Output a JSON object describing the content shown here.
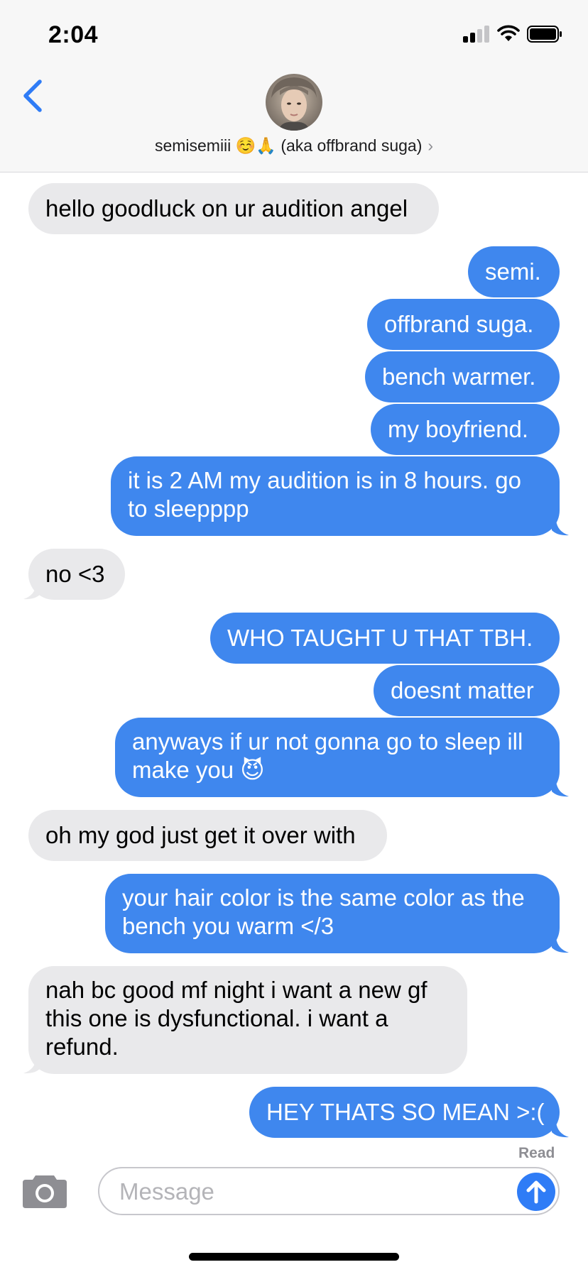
{
  "status_bar": {
    "time": "2:04"
  },
  "header": {
    "contact_name": "semisemiii ☺️🙏 (aka offbrand suga)",
    "chevron": "›"
  },
  "messages": [
    {
      "from": "them",
      "text": "hello goodluck on ur audition angel"
    },
    {
      "from": "me",
      "text": "semi."
    },
    {
      "from": "me",
      "text": "offbrand suga."
    },
    {
      "from": "me",
      "text": "bench warmer."
    },
    {
      "from": "me",
      "text": "my boyfriend."
    },
    {
      "from": "me",
      "text": "it is 2 AM my audition is in 8 hours. go to sleepppp"
    },
    {
      "from": "them",
      "text": "no <3"
    },
    {
      "from": "me",
      "text": "WHO TAUGHT U THAT TBH."
    },
    {
      "from": "me",
      "text": "doesnt matter"
    },
    {
      "from": "me",
      "text": "anyways if ur not gonna go to sleep ill make you 😈"
    },
    {
      "from": "them",
      "text": "oh my god just get it over with"
    },
    {
      "from": "me",
      "text": "your hair color is the same color as the bench you warm </3"
    },
    {
      "from": "them",
      "text": "nah bc good mf night i want a new gf this one is dysfunctional. i want a refund."
    },
    {
      "from": "me",
      "text": "HEY THATS SO MEAN >:("
    }
  ],
  "read_receipt": "Read",
  "composer": {
    "placeholder": "Message"
  },
  "icons": {
    "back": "chevron-left-icon",
    "camera": "camera-icon",
    "send": "arrow-up-icon",
    "signal": "cellular-signal-icon",
    "wifi": "wifi-icon",
    "battery": "battery-icon"
  },
  "colors": {
    "sent_bubble": "#3f87ee",
    "received_bubble": "#e9e9eb",
    "accent": "#2f7cf6",
    "header_bg": "#f7f7f7"
  }
}
